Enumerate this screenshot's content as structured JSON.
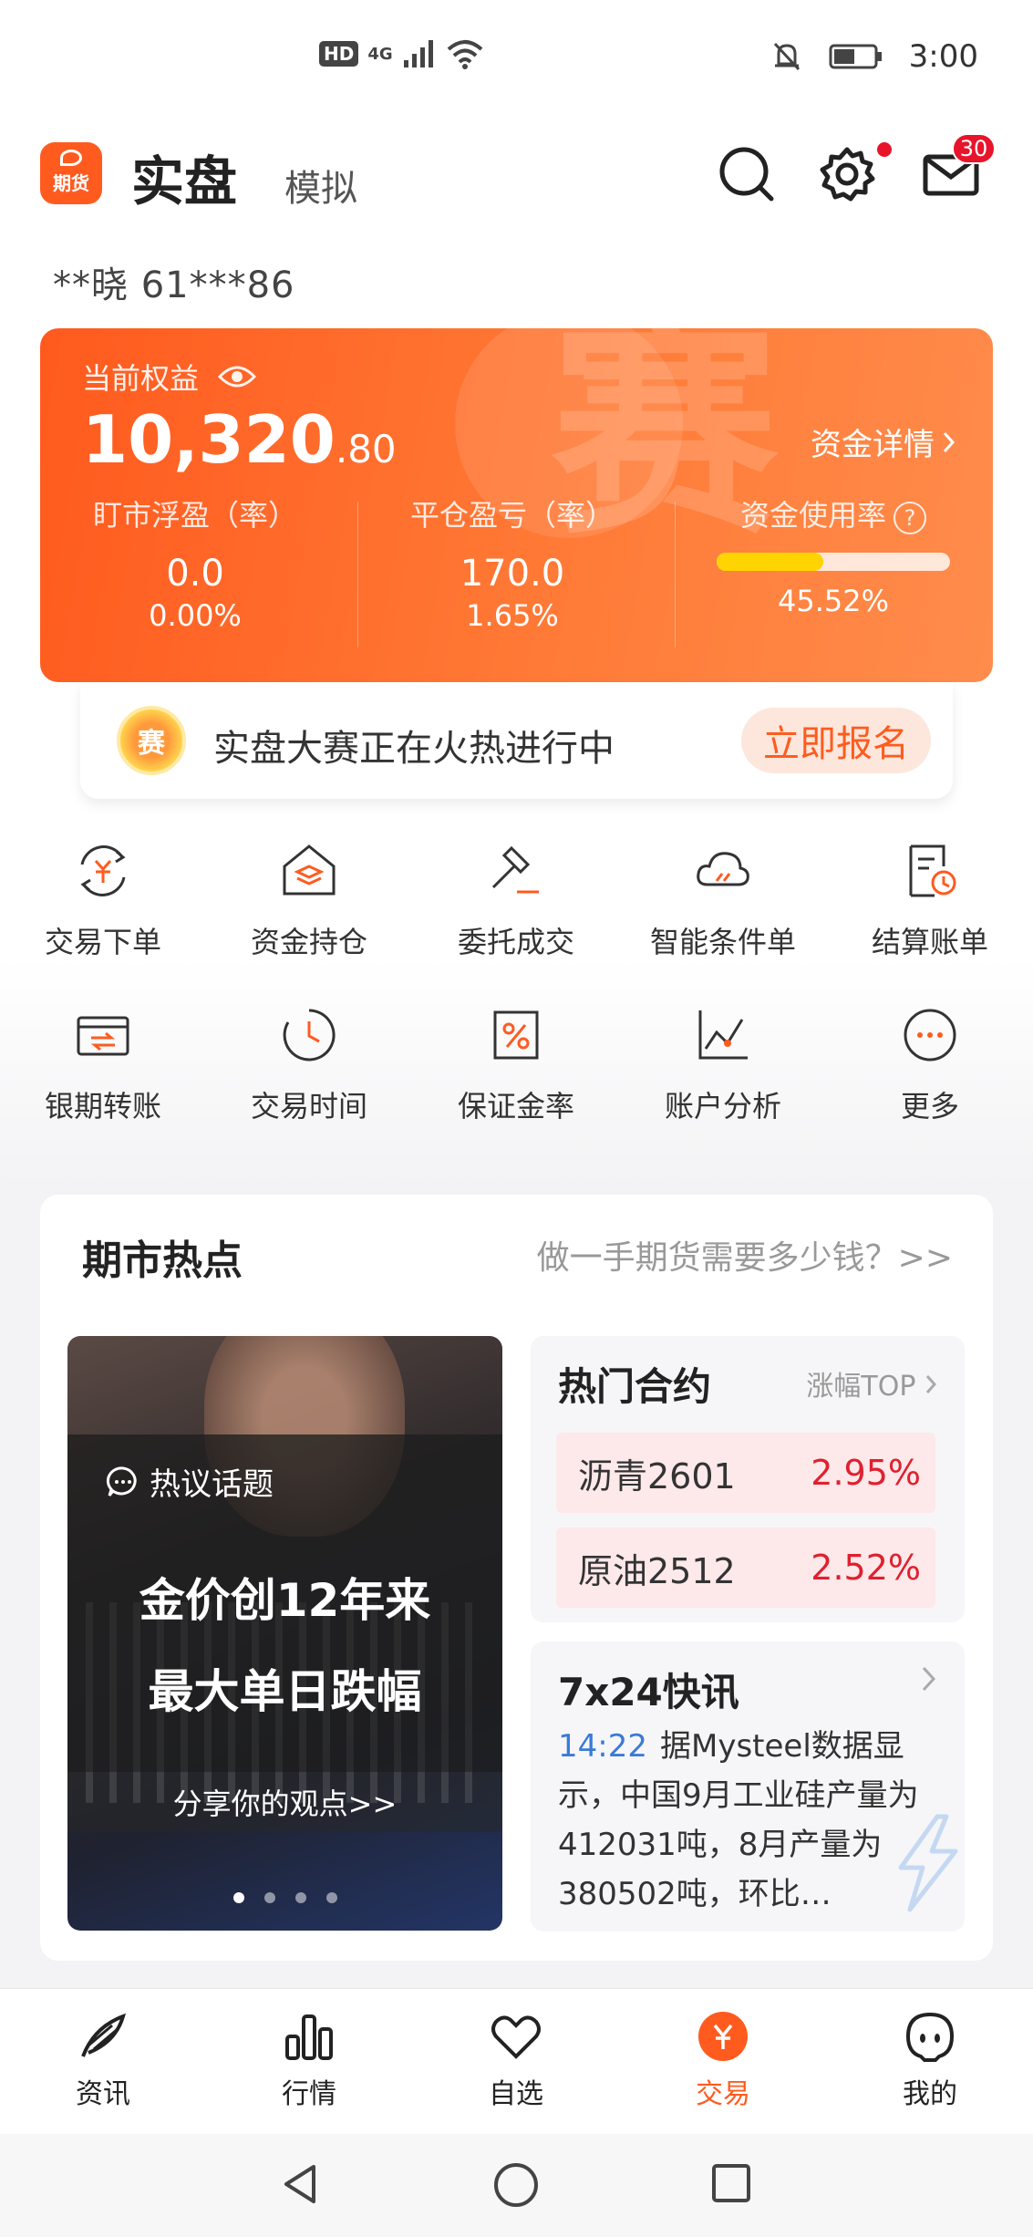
{
  "status_bar": {
    "hd": "HD",
    "network": "4G",
    "time": "3:00"
  },
  "header": {
    "logo_text": "期货",
    "tab_real": "实盘",
    "tab_sim": "模拟",
    "mail_count": "30"
  },
  "account": {
    "label": "**晓  61***86"
  },
  "equity": {
    "label": "当前权益",
    "value_int": "10,320",
    "value_dec": ".80",
    "detail_link": "资金详情",
    "deco_text": "赛",
    "floating_pl_label": "盯市浮盈（率）",
    "floating_pl_value": "0.0",
    "floating_pl_rate": "0.00%",
    "close_pl_label": "平仓盈亏（率）",
    "close_pl_value": "170.0",
    "close_pl_rate": "1.65%",
    "usage_label": "资金使用率",
    "usage_rate": "45.52%",
    "usage_fraction": 0.4552,
    "usage_help": "?"
  },
  "contest": {
    "icon_text": "赛",
    "text": "实盘大赛正在火热进行中",
    "button": "立即报名"
  },
  "menu": [
    {
      "label": "交易下单",
      "icon": "trade-order-icon"
    },
    {
      "label": "资金持仓",
      "icon": "fund-position-icon"
    },
    {
      "label": "委托成交",
      "icon": "hammer-icon"
    },
    {
      "label": "智能条件单",
      "icon": "cloud-condition-icon"
    },
    {
      "label": "结算账单",
      "icon": "settlement-bill-icon"
    },
    {
      "label": "银期转账",
      "icon": "bank-transfer-icon"
    },
    {
      "label": "交易时间",
      "icon": "clock-icon"
    },
    {
      "label": "保证金率",
      "icon": "percent-icon"
    },
    {
      "label": "账户分析",
      "icon": "line-chart-icon"
    },
    {
      "label": "更多",
      "icon": "more-icon"
    }
  ],
  "hot": {
    "title": "期市热点",
    "link": "做一手期货需要多少钱？>>",
    "topic_tag": "热议话题",
    "topic_line1": "金价创12年来",
    "topic_line2": "最大单日跌幅",
    "topic_share": "分享你的观点>>",
    "contracts_title": "热门合约",
    "contracts_more": "涨幅TOP",
    "contracts": [
      {
        "name": "沥青2601",
        "change": "2.95%"
      },
      {
        "name": "原油2512",
        "change": "2.52%"
      }
    ],
    "news_title": "7x24快讯",
    "news_time": "14:22",
    "news_text": "据Mysteel数据显示，中国9月工业硅产量为412031吨，8月产量为380502吨，环比…"
  },
  "bottom_nav": [
    {
      "label": "资讯"
    },
    {
      "label": "行情"
    },
    {
      "label": "自选"
    },
    {
      "label": "交易"
    },
    {
      "label": "我的"
    }
  ],
  "colors": {
    "brand": "#ff5b1f",
    "up": "#e0202e",
    "link_blue": "#3a7bd5"
  }
}
